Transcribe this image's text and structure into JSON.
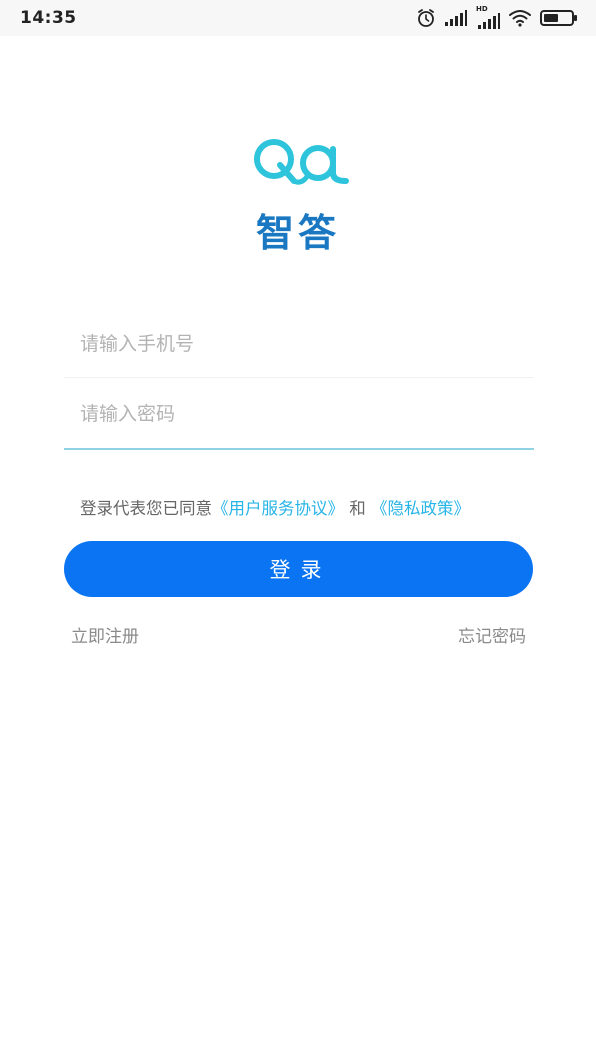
{
  "status_bar": {
    "time": "14:35",
    "hd_label": "HD"
  },
  "app": {
    "name": "智答"
  },
  "form": {
    "phone_placeholder": "请输入手机号",
    "password_placeholder": "请输入密码"
  },
  "agreement": {
    "prefix": "登录代表您已同意",
    "user_agreement": "《用户服务协议》",
    "and": "和",
    "privacy_policy": "《隐私政策》"
  },
  "actions": {
    "login_label": "登录",
    "register_label": "立即注册",
    "forgot_label": "忘记密码"
  },
  "colors": {
    "brand": "#1a78c2",
    "logo": "#2ec4dc",
    "primary_button": "#0b74f2",
    "link": "#27b4e6"
  }
}
